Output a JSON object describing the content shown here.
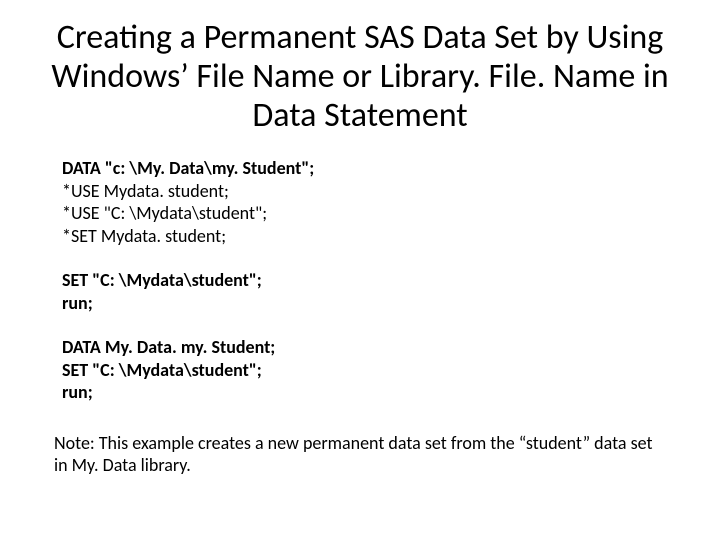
{
  "title": "Creating a Permanent SAS Data Set by Using Windows’ File Name or Library. File. Name in Data Statement",
  "block1": {
    "l1": "DATA \"c: \\My. Data\\my. Student\";",
    "l2": "*USE Mydata. student;",
    "l3": "*USE \"C: \\Mydata\\student\";",
    "l4": "*SET Mydata. student;"
  },
  "block2": {
    "l1": "SET \"C: \\Mydata\\student\";",
    "l2": "run;"
  },
  "block3": {
    "l1": "DATA My. Data. my. Student;",
    "l2": "SET \"C: \\Mydata\\student\";",
    "l3": "run;"
  },
  "note": "Note: This example creates a new permanent data set from the “student” data set in My. Data library."
}
